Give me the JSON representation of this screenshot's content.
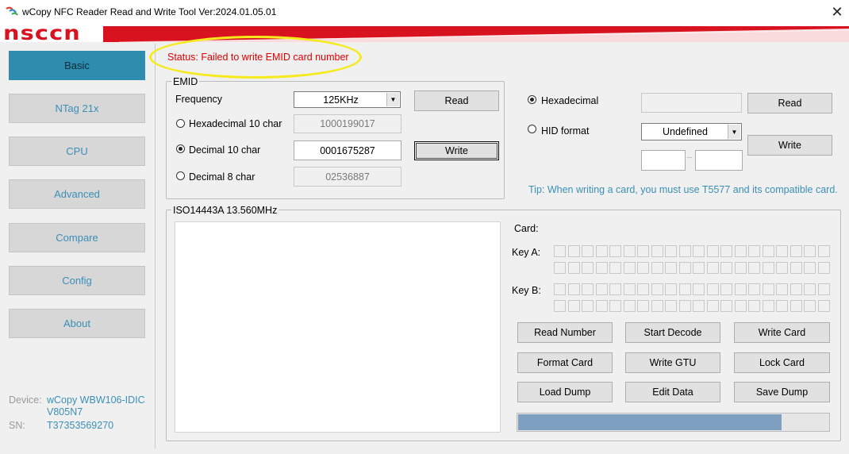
{
  "window": {
    "title": "wCopy NFC Reader Read and Write Tool  Ver:2024.01.05.01",
    "logo": "nsccn"
  },
  "sidebar": {
    "items": [
      {
        "label": "Basic",
        "active": true
      },
      {
        "label": "NTag 21x",
        "active": false
      },
      {
        "label": "CPU",
        "active": false
      },
      {
        "label": "Advanced",
        "active": false
      },
      {
        "label": "Compare",
        "active": false
      },
      {
        "label": "Config",
        "active": false
      },
      {
        "label": "About",
        "active": false
      }
    ],
    "device_label": "Device:",
    "device_value_line1": "wCopy WBW106-IDIC",
    "device_value_line2": "V805N7",
    "sn_label": "SN:",
    "sn_value": "T37353569270"
  },
  "status": {
    "text": "Status: Failed to write EMID card number"
  },
  "emid": {
    "title": "EMID",
    "frequency_label": "Frequency",
    "frequency_value": "125KHz",
    "read_button": "Read",
    "write_button": "Write",
    "hex10_label": "Hexadecimal 10 char",
    "hex10_value": "1000199017",
    "dec10_label": "Decimal 10 char",
    "dec10_value": "0001675287",
    "dec8_label": "Decimal 8 char",
    "dec8_value": "02536887",
    "selected": "dec10"
  },
  "hid": {
    "hex_label": "Hexadecimal",
    "hid_label": "HID format",
    "hex_value": "",
    "format_value": "Undefined",
    "field1": "",
    "field2": "",
    "separator": "--",
    "read_button": "Read",
    "write_button": "Write",
    "selected": "hex",
    "tip": "Tip: When writing a card, you must use T5577 and its compatible card."
  },
  "iso": {
    "title": "ISO14443A 13.560MHz",
    "card_label": "Card:",
    "key_a_label": "Key A:",
    "key_b_label": "Key B:",
    "buttons": [
      "Read Number",
      "Start Decode",
      "Write Card",
      "Format Card",
      "Write GTU",
      "Lock Card",
      "Load Dump",
      "Edit Data",
      "Save Dump"
    ],
    "progress": 0.85
  },
  "colors": {
    "accent": "#2e8cae",
    "status_error": "#e00000",
    "link": "#3a8fb7",
    "brand_red": "#d8121e",
    "highlight": "#f5ea1b"
  },
  "icons": {
    "app": "wcopy-app-icon",
    "close": "close-icon"
  }
}
